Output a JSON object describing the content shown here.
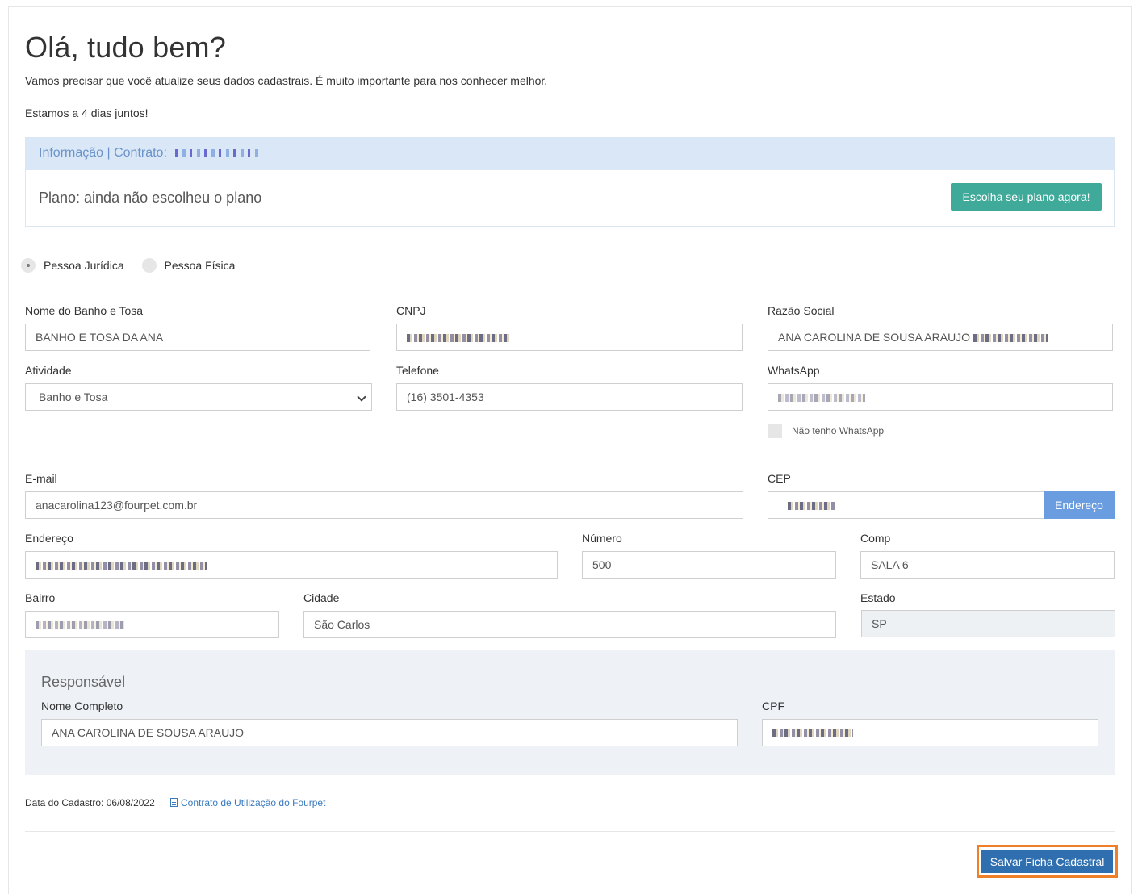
{
  "header": {
    "greeting": "Olá, tudo bem?",
    "intro": "Vamos precisar que você atualize seus dados cadastrais. É muito importante para nos conhecer melhor.",
    "days_together": "Estamos a 4 dias juntos!"
  },
  "info": {
    "title": "Informação | Contrato:",
    "plan": "Plano: ainda não escolheu o plano",
    "choose_plan_label": "Escolha seu plano agora!"
  },
  "person_type": {
    "options": [
      "Pessoa Jurídica",
      "Pessoa Física"
    ],
    "selected": "Pessoa Jurídica"
  },
  "form": {
    "nome_label": "Nome do Banho e Tosa",
    "nome_value": "BANHO E TOSA DA ANA",
    "cnpj_label": "CNPJ",
    "razao_label": "Razão Social",
    "razao_value": "ANA CAROLINA DE SOUSA ARAUJO",
    "atividade_label": "Atividade",
    "atividade_value": "Banho e Tosa",
    "telefone_label": "Telefone",
    "telefone_value": "(16) 3501-4353",
    "whatsapp_label": "WhatsApp",
    "no_whatsapp_label": "Não tenho WhatsApp",
    "email_label": "E-mail",
    "email_value": "anacarolina123@fourpet.com.br",
    "cep_label": "CEP",
    "endereco_button": "Endereço",
    "endereco_label": "Endereço",
    "numero_label": "Número",
    "numero_value": "500",
    "comp_label": "Comp",
    "comp_value": "SALA 6",
    "bairro_label": "Bairro",
    "cidade_label": "Cidade",
    "cidade_value": "São Carlos",
    "estado_label": "Estado",
    "estado_value": "SP"
  },
  "responsavel": {
    "title": "Responsável",
    "nome_label": "Nome Completo",
    "nome_value": "ANA CAROLINA DE SOUSA ARAUJO",
    "cpf_label": "CPF"
  },
  "footer": {
    "date": "Data do Cadastro: 06/08/2022",
    "contract_link": "Contrato de Utilização do Fourpet",
    "save_label": "Salvar Ficha Cadastral"
  },
  "colors": {
    "accent_teal": "#3fa99a",
    "info_bg": "#d9e7f7",
    "primary_blue": "#2f6fb0",
    "highlight_orange": "#f07f2a"
  }
}
